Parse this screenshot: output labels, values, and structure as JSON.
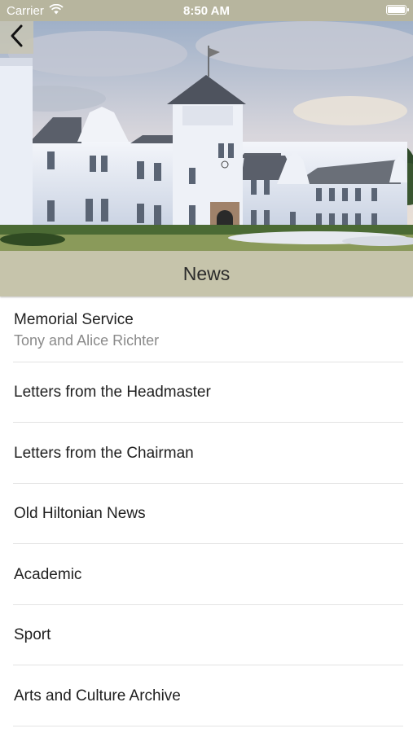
{
  "status_bar": {
    "carrier": "Carrier",
    "time": "8:50 AM",
    "battery_level": 1.0
  },
  "nav": {
    "back_icon": "chevron-left-icon"
  },
  "header": {
    "title": "News"
  },
  "news_items": [
    {
      "title": "Memorial Service",
      "subtitle": "Tony and Alice Richter"
    },
    {
      "title": "Letters from the Headmaster"
    },
    {
      "title": "Letters from the Chairman"
    },
    {
      "title": "Old Hiltonian News"
    },
    {
      "title": "Academic"
    },
    {
      "title": "Sport"
    },
    {
      "title": "Arts and Culture Archive"
    }
  ],
  "colors": {
    "accent": "#c6c4ab",
    "status_bar": "#b7b59e"
  }
}
